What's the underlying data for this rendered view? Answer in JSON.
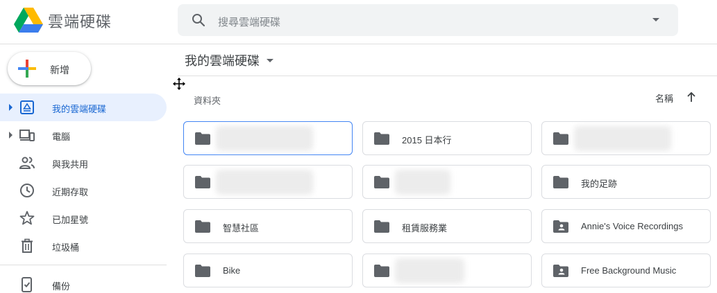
{
  "app": {
    "name": "雲端硬碟",
    "logo_icon": "google-drive-logo"
  },
  "search": {
    "placeholder": "搜尋雲端硬碟",
    "icon": "search-icon",
    "options_icon": "dropdown-caret"
  },
  "new_button": {
    "label": "新增",
    "icon": "colored-plus-icon"
  },
  "sidebar": {
    "items": [
      {
        "label": "我的雲端硬碟",
        "icon": "my-drive-icon",
        "active": true,
        "expandable": true
      },
      {
        "label": "電腦",
        "icon": "computers-icon",
        "active": false,
        "expandable": true
      },
      {
        "label": "與我共用",
        "icon": "shared-people-icon",
        "active": false,
        "expandable": false
      },
      {
        "label": "近期存取",
        "icon": "clock-icon",
        "active": false,
        "expandable": false
      },
      {
        "label": "已加星號",
        "icon": "star-icon",
        "active": false,
        "expandable": false
      },
      {
        "label": "垃圾桶",
        "icon": "trash-icon",
        "active": false,
        "expandable": false
      },
      {
        "label": "備份",
        "icon": "backup-icon",
        "active": false,
        "expandable": false
      }
    ]
  },
  "main": {
    "breadcrumb": "我的雲端硬碟",
    "section_title": "資料夾",
    "sort": {
      "label": "名稱",
      "direction": "ascending"
    },
    "folders": [
      {
        "name": "",
        "type": "folder",
        "blurred": true,
        "selected": true
      },
      {
        "name": "2015 日本行",
        "type": "folder",
        "blurred": false
      },
      {
        "name": "",
        "type": "folder",
        "blurred": true
      },
      {
        "name": "",
        "type": "folder",
        "blurred": true
      },
      {
        "name": "",
        "type": "folder",
        "blurred": true
      },
      {
        "name": "我的足跡",
        "type": "folder",
        "blurred": false
      },
      {
        "name": "智慧社區",
        "type": "folder",
        "blurred": false
      },
      {
        "name": "租賃服務業",
        "type": "folder",
        "blurred": false
      },
      {
        "name": "Annie's Voice Recordings",
        "type": "shared-folder",
        "blurred": false
      },
      {
        "name": "Bike",
        "type": "folder",
        "blurred": false
      },
      {
        "name": "",
        "type": "folder",
        "blurred": true
      },
      {
        "name": "Free Background Music",
        "type": "shared-folder",
        "blurred": false
      }
    ]
  },
  "colors": {
    "accent": "#1967d2",
    "active_bg": "#e8f0fe",
    "selected_border": "#4285f4",
    "folder_icon": "#5f6368"
  }
}
